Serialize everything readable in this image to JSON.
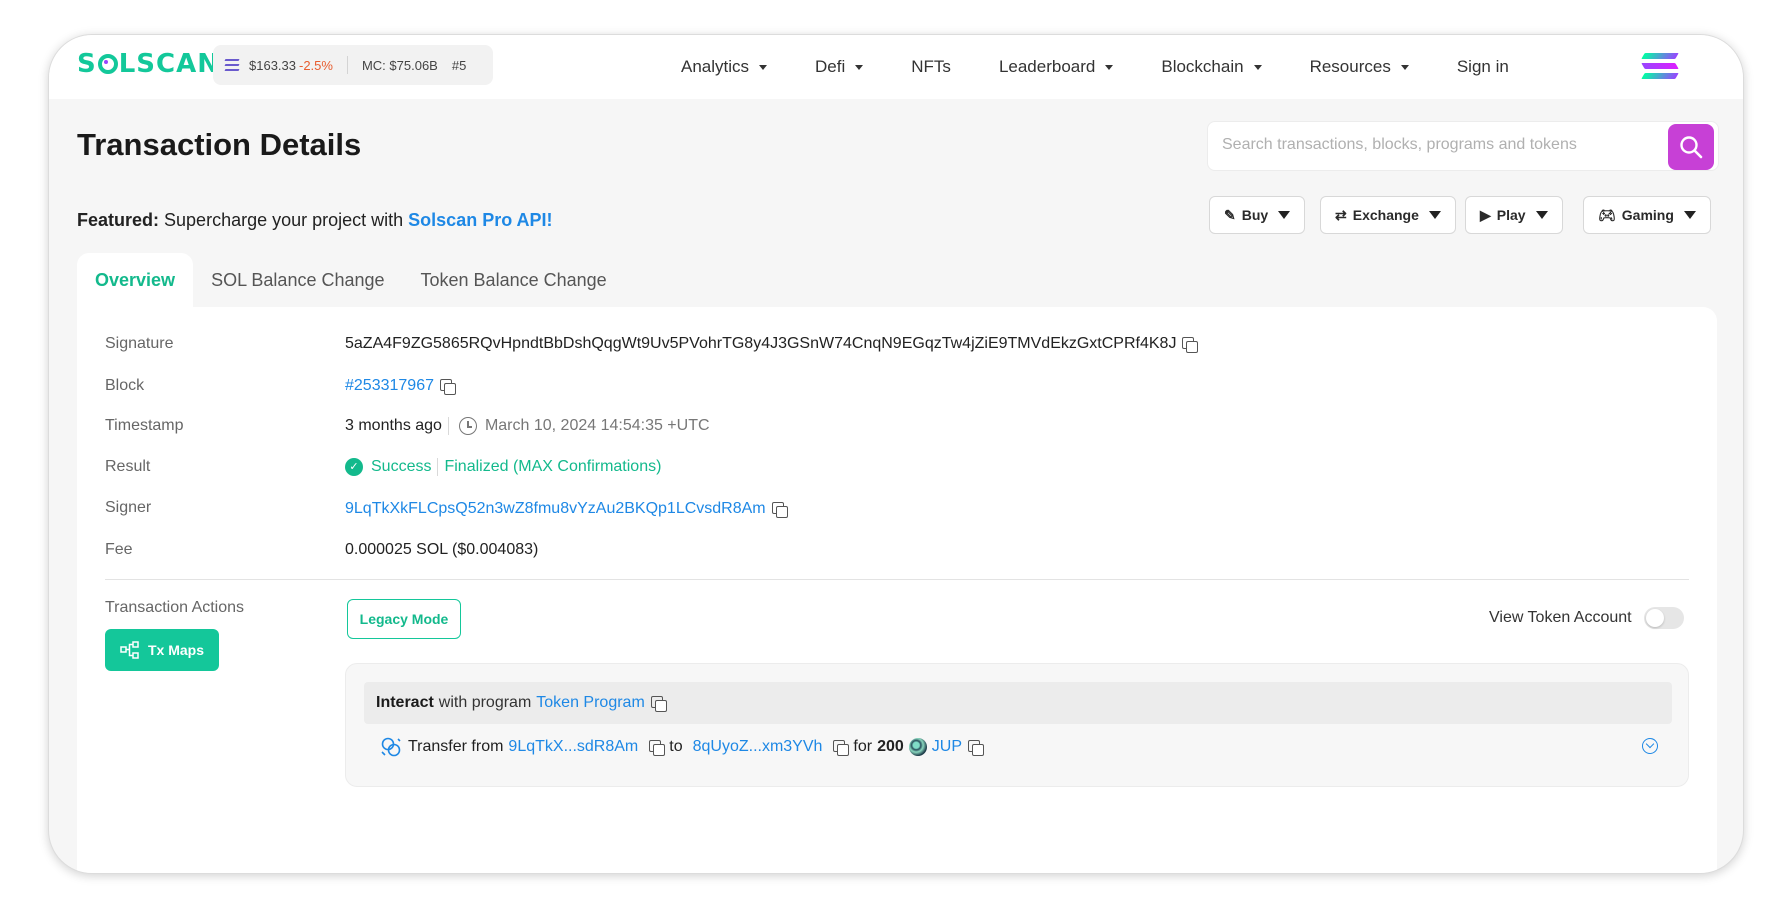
{
  "header": {
    "logo": "SOLSCAN",
    "price": "$163.33",
    "change": "-2.5%",
    "market_cap": "MC: $75.06B",
    "rank": "#5",
    "nav": [
      "Analytics",
      "Defi",
      "NFTs",
      "Leaderboard",
      "Blockchain",
      "Resources",
      "Sign in"
    ]
  },
  "page": {
    "title": "Transaction Details",
    "search_placeholder": "Search transactions, blocks, programs and tokens",
    "featured_label": "Featured:",
    "featured_text": "Supercharge your project with",
    "featured_link": "Solscan Pro API!",
    "quick_buttons": [
      "Buy",
      "Exchange",
      "Play",
      "Gaming"
    ]
  },
  "tabs": [
    "Overview",
    "SOL Balance Change",
    "Token Balance Change"
  ],
  "details": {
    "signature_label": "Signature",
    "signature": "5aZA4F9ZG5865RQvHpndtBbDshQqgWt9Uv5PVohrTG8y4J3GSnW74CnqN9EGqzTw4jZiE9TMVdEkzGxtCPRf4K8J",
    "block_label": "Block",
    "block": "#253317967",
    "timestamp_label": "Timestamp",
    "timestamp_relative": "3 months ago",
    "timestamp_absolute": "March 10, 2024 14:54:35 +UTC",
    "result_label": "Result",
    "result": "Success",
    "result_status": "Finalized (MAX Confirmations)",
    "signer_label": "Signer",
    "signer": "9LqTkXkFLCpsQ52n3wZ8fmu8vYzAu2BKQp1LCvsdR8Am",
    "fee_label": "Fee",
    "fee": "0.000025 SOL ($0.004083)"
  },
  "actions": {
    "label": "Transaction Actions",
    "tx_maps": "Tx Maps",
    "legacy_mode": "Legacy Mode",
    "view_token_account": "View Token Account",
    "interact_bold": "Interact",
    "interact_text": "with program",
    "program": "Token Program",
    "transfer_from_label": "Transfer from",
    "from": "9LqTkX...sdR8Am",
    "to_label": "to",
    "to": "8qUyoZ...xm3YVh",
    "for_label": "for",
    "amount": "200",
    "token": "JUP"
  },
  "colors": {
    "brand": "#13c89a",
    "link": "#1e88e5",
    "search_button": "#c740d6",
    "negative": "#e85d2f"
  }
}
